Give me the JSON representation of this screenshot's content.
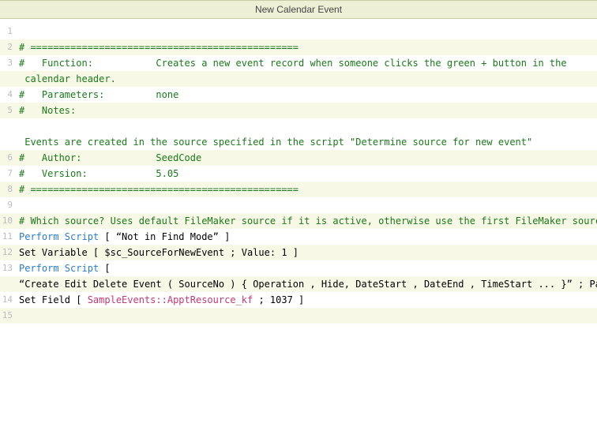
{
  "title": "New Calendar Event",
  "lines": [
    {
      "n": 1,
      "hl": false,
      "segs": []
    },
    {
      "n": 2,
      "hl": true,
      "segs": [
        {
          "cls": "c-comment",
          "t": "# ==============================================="
        }
      ]
    },
    {
      "n": 3,
      "hl": false,
      "segs": [
        {
          "cls": "c-comment",
          "t": "#   Function:           Creates a new event record when someone clicks the green + button in the"
        }
      ],
      "cont": [
        {
          "cls": "c-comment",
          "t": " calendar header."
        }
      ],
      "cont_hl": true
    },
    {
      "n": 4,
      "hl": false,
      "segs": [
        {
          "cls": "c-comment",
          "t": "#   Parameters:         none"
        }
      ]
    },
    {
      "n": 5,
      "hl": true,
      "segs": [
        {
          "cls": "c-comment",
          "t": "#   Notes:              "
        }
      ],
      "blank_after": true,
      "cont": [
        {
          "cls": "c-comment",
          "t": " Events are created in the source specified in the script \"Determine source for new event\""
        }
      ],
      "cont_hl": false
    },
    {
      "n": 6,
      "hl": true,
      "segs": [
        {
          "cls": "c-comment",
          "t": "#   Author:             SeedCode"
        }
      ]
    },
    {
      "n": 7,
      "hl": false,
      "segs": [
        {
          "cls": "c-comment",
          "t": "#   Version:            5.05"
        }
      ]
    },
    {
      "n": 8,
      "hl": true,
      "segs": [
        {
          "cls": "c-comment",
          "t": "# ==============================================="
        }
      ]
    },
    {
      "n": 9,
      "hl": false,
      "segs": []
    },
    {
      "n": 10,
      "hl": true,
      "segs": [
        {
          "cls": "c-comment",
          "t": "# Which source? Uses default FileMaker source if it is active, otherwise use the first FileMaker source."
        }
      ]
    },
    {
      "n": 11,
      "hl": false,
      "segs": [
        {
          "cls": "c-keyword",
          "t": "Perform Script"
        },
        {
          "cls": "",
          "t": " [ “Not in Find Mode” ]"
        }
      ]
    },
    {
      "n": 12,
      "hl": true,
      "segs": [
        {
          "cls": "",
          "t": "Set Variable [ $sc_SourceForNewEvent ; Value: 1 ]"
        }
      ]
    },
    {
      "n": 13,
      "hl": false,
      "segs": [
        {
          "cls": "c-keyword",
          "t": "Perform Script"
        },
        {
          "cls": "",
          "t": " ["
        }
      ],
      "cont": [
        {
          "cls": "",
          "t": "“Create Edit Delete Event ( SourceNo ) { Operation , Hide, DateStart , DateEnd , TimeStart ... }” ; Parameter… ]"
        }
      ],
      "cont_hl": true
    },
    {
      "n": 14,
      "hl": false,
      "segs": [
        {
          "cls": "",
          "t": "Set Field [ "
        },
        {
          "cls": "c-field",
          "t": "SampleEvents::ApptResource_kf"
        },
        {
          "cls": "",
          "t": " ; 1037 ]"
        }
      ]
    },
    {
      "n": 15,
      "hl": true,
      "segs": []
    }
  ]
}
